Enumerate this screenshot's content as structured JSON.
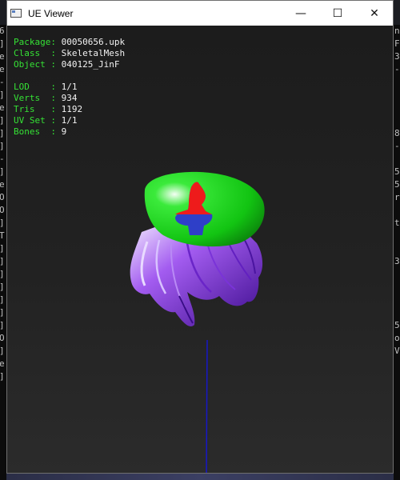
{
  "window": {
    "title": "UE Viewer"
  },
  "controls": {
    "minimize": "—",
    "maximize": "☐",
    "close": "✕"
  },
  "info": {
    "package_key": "Package: ",
    "package": "00050656.upk",
    "class_key": "Class  : ",
    "class": "SkeletalMesh",
    "object_key": "Object : ",
    "object": "040125_JinF",
    "lod_key": "LOD    : ",
    "lod": "1/1",
    "verts_key": "Verts  : ",
    "verts": "934",
    "tris_key": "Tris   : ",
    "tris": "1192",
    "uvset_key": "UV Set : ",
    "uvset": "1/1",
    "bones_key": "Bones  : ",
    "bones": "9"
  },
  "background_console": {
    "left": [
      "6",
      "]",
      "e",
      "e",
      "-",
      "]",
      "e",
      "]",
      "]",
      "]",
      "-",
      "]",
      "e",
      "O",
      "O",
      "]",
      "T",
      "]",
      "]",
      "]",
      "]",
      "]",
      "]",
      "]",
      "O",
      "]",
      "e",
      "]"
    ],
    "right": [
      "n",
      "F",
      "3",
      "-",
      "",
      "",
      "",
      "",
      "8",
      "-",
      "",
      "5",
      "5",
      "r",
      "",
      "t",
      "",
      "",
      "3",
      "",
      "",
      "",
      "",
      "5",
      "o",
      "V",
      ""
    ]
  },
  "colors": {
    "info_label": "#35e135",
    "info_value": "#f2f2f2",
    "hat": "#18d818",
    "hair": "#8a2be2"
  },
  "mesh": {
    "object": "040125_JinF",
    "parts": [
      "hair",
      "beret",
      "emblem",
      "bone-axis"
    ]
  }
}
